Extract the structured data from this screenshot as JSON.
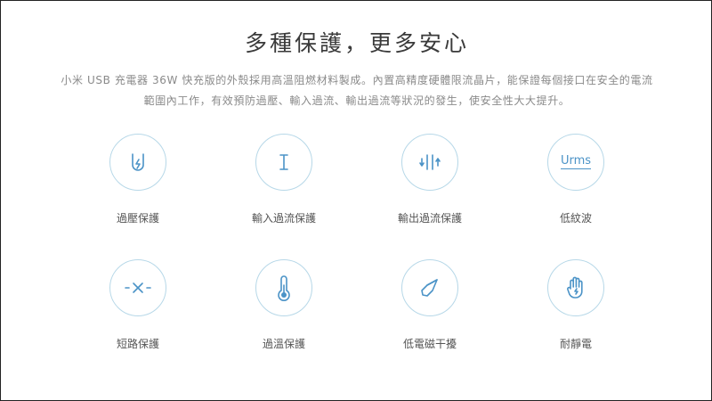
{
  "title": "多種保護，更多安心",
  "description_line1": "小米 USB 充電器 36W 快充版的外殼採用高溫阻燃材料製成。內置高精度硬體限流晶片，能保證每個接口在安全的電流",
  "description_line2": "範圍內工作，有效預防過壓、輸入過流、輸出過流等狀況的發生，使安全性大大提升。",
  "accent_color": "#4b93c7",
  "features": [
    {
      "label": "過壓保護",
      "icon": "overvoltage-icon"
    },
    {
      "label": "輸入過流保護",
      "icon": "input-current-icon"
    },
    {
      "label": "輸出過流保護",
      "icon": "output-current-icon"
    },
    {
      "label": "低紋波",
      "icon": "urms-icon",
      "icon_text": "Urms"
    },
    {
      "label": "短路保護",
      "icon": "short-circuit-icon"
    },
    {
      "label": "過溫保護",
      "icon": "thermometer-icon"
    },
    {
      "label": "低電磁干擾",
      "icon": "compass-icon"
    },
    {
      "label": "耐靜電",
      "icon": "hand-icon"
    }
  ]
}
